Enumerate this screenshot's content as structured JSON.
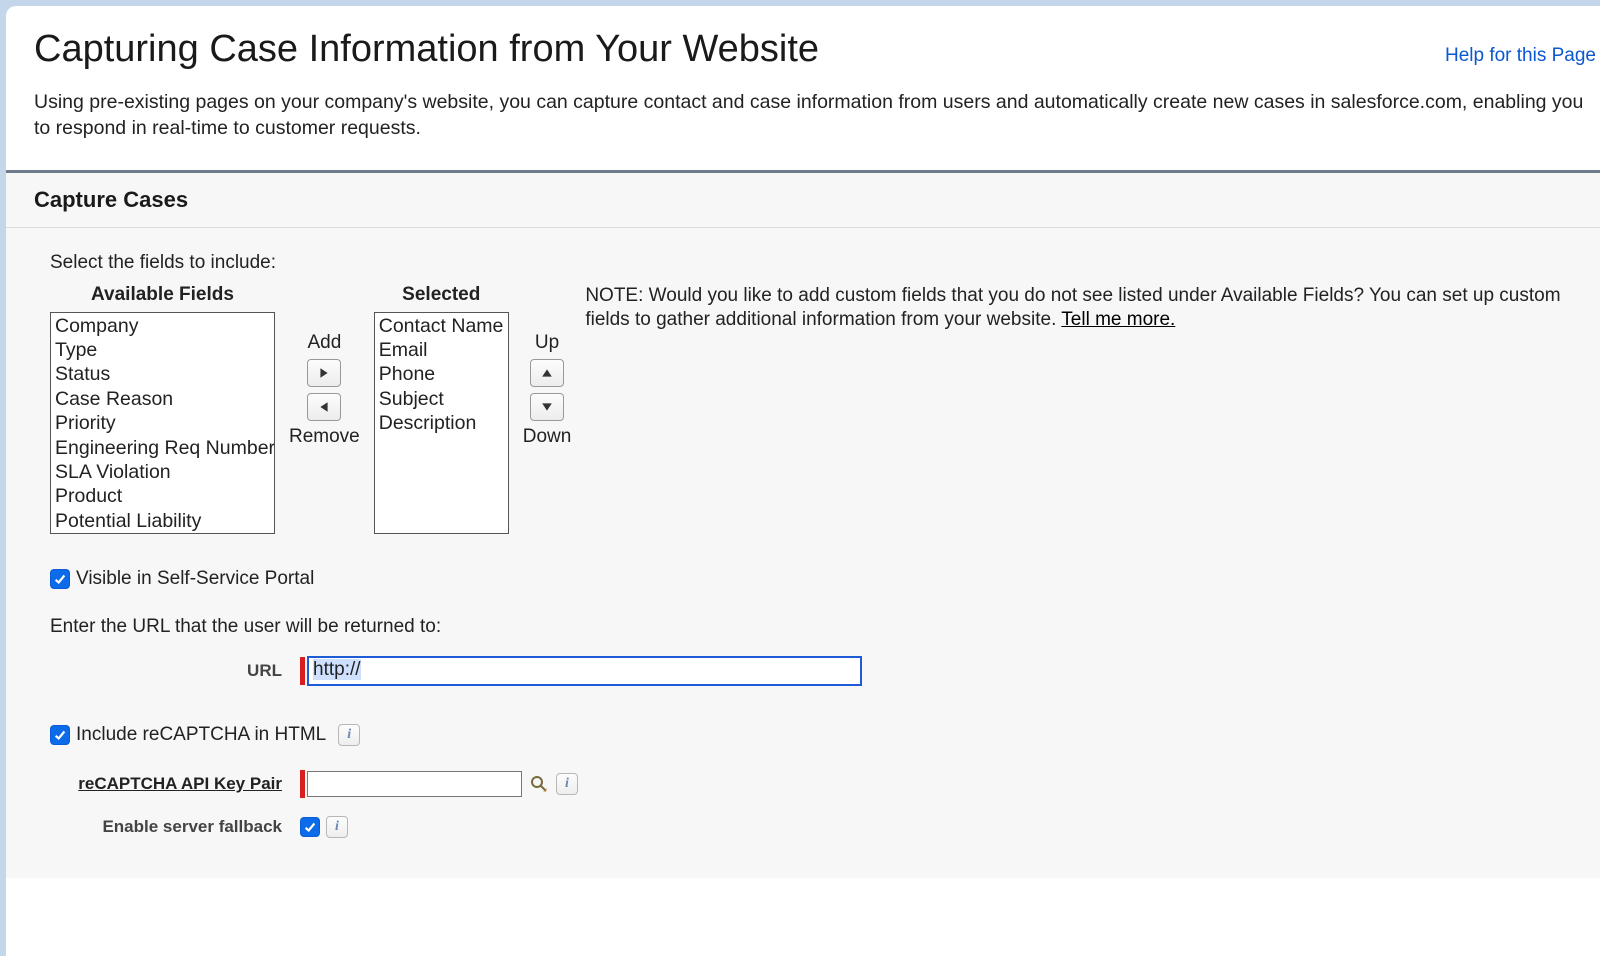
{
  "header": {
    "title": "Capturing Case Information from Your Website",
    "help_link": "Help for this Page"
  },
  "intro": "Using pre-existing pages on your company's website, you can capture contact and case information from users and automatically create new cases in salesforce.com, enabling you to respond in real-time to customer requests.",
  "section": {
    "title": "Capture Cases",
    "select_prompt": "Select the fields to include:",
    "available_label": "Available Fields",
    "selected_label": "Selected",
    "add_label": "Add",
    "remove_label": "Remove",
    "up_label": "Up",
    "down_label": "Down",
    "available_fields": [
      "Company",
      "Type",
      "Status",
      "Case Reason",
      "Priority",
      "Engineering Req Number",
      "SLA Violation",
      "Product",
      "Potential Liability"
    ],
    "selected_fields": [
      "Contact Name",
      "Email",
      "Phone",
      "Subject",
      "Description"
    ],
    "note_prefix": "NOTE: Would you like to add custom fields that you do not see listed under Available Fields? You can set up custom fields to gather additional information from your website. ",
    "note_link": "Tell me more.",
    "visible_checkbox_label": "Visible in Self-Service Portal",
    "return_url_prompt": "Enter the URL that the user will be returned to:",
    "url_label": "URL",
    "url_value": "http://",
    "include_recaptcha_label": "Include reCAPTCHA in HTML",
    "recaptcha_key_label": "reCAPTCHA API Key Pair",
    "server_fallback_label": "Enable server fallback"
  }
}
